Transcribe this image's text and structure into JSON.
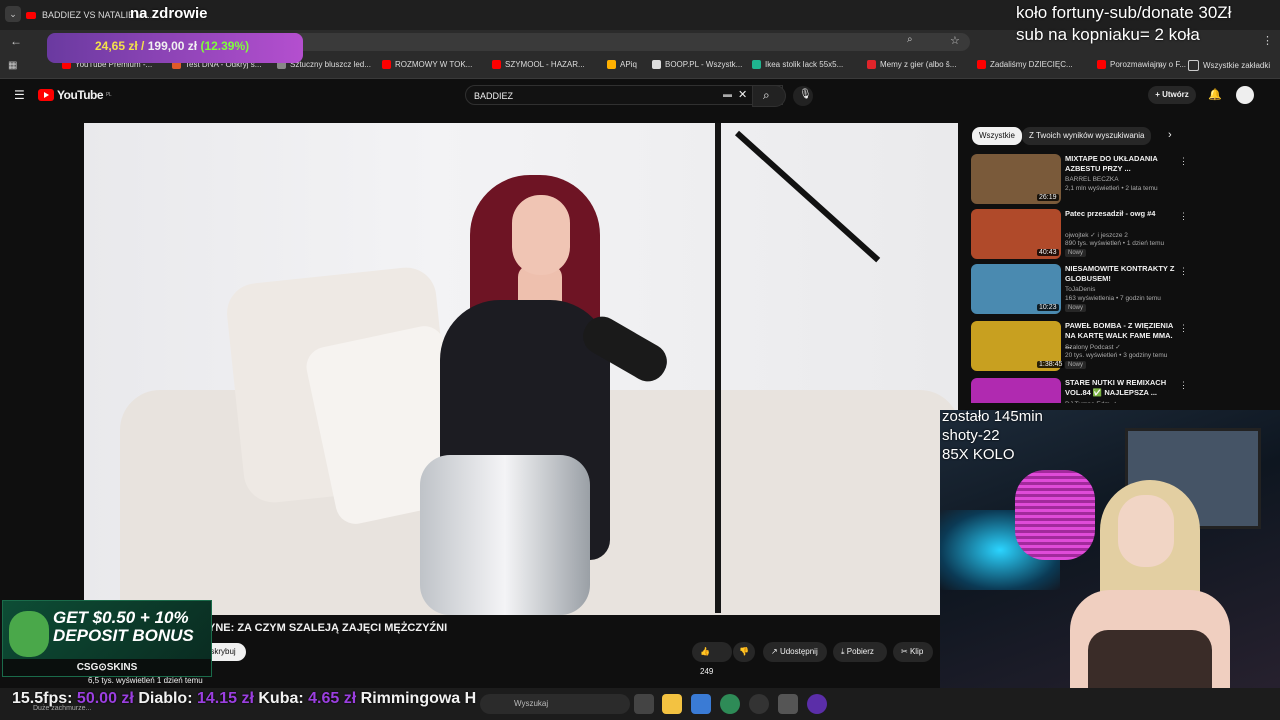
{
  "browser": {
    "tab_title": "BADDIEZ VS NATALIE W...",
    "bookmarks": [
      {
        "label": "YouTube Premium -...",
        "color": "#ff0000"
      },
      {
        "label": "Test DNA - Odkryj s...",
        "color": "#e05a2a"
      },
      {
        "label": "Sztuczny bluszcz led...",
        "color": "#888888"
      },
      {
        "label": "ROZMOWY W TOK...",
        "color": "#ff0000"
      },
      {
        "label": "SZYMOOL - HAZAR...",
        "color": "#ff0000"
      },
      {
        "label": "APiq",
        "color": "#ffb000"
      },
      {
        "label": "BOOP.PL - Wszystk...",
        "color": "#dddddd"
      },
      {
        "label": "Ikea stolik lack 55x5...",
        "color": "#1fb58f"
      },
      {
        "label": "Memy z gier (albo š...",
        "color": "#e0242a"
      },
      {
        "label": "Zadaliśmy DZIECIĘC...",
        "color": "#ff0000"
      },
      {
        "label": "Porozmawiajmy o F...",
        "color": "#ff0000"
      }
    ],
    "all_bookmarks": "Wszystkie zakładki"
  },
  "youtube": {
    "logo": "YouTube",
    "logo_region": "PL",
    "search_value": "BADDIEZ",
    "create_label": "Utwórz",
    "video_title": "YNE: ZA CZYM SZALEJĄ ZAJĘCI MĘŻCZYŹNI",
    "subscribe_label": "skrybuj",
    "likes": "249",
    "share_label": "Udostępnij",
    "download_label": "Pobierz",
    "clip_label": "Klip",
    "views": "6,5 tys. wyświetleń  1 dzień temu",
    "description": "Duże zachmurze..."
  },
  "sidebar": {
    "chips": [
      "Wszystkie",
      "Z Twoich wyników wyszukiwania"
    ],
    "recommendations": [
      {
        "title": "MIXTAPE DO UKŁADANIA AZBESTU PRZY ...",
        "channel": "BARREL BECZKA",
        "meta": "2,1 mln wyświetleń • 2 lata temu",
        "duration": "26:19",
        "badge": "",
        "thumb": "#7a5a3a"
      },
      {
        "title": "Patec przesadził - owg #4",
        "channel": "ojwojtek ✓ i jeszcze 2",
        "meta": "890 tys. wyświetleń • 1 dzień temu",
        "duration": "40:43",
        "badge": "Nowy",
        "thumb": "#b04a2a"
      },
      {
        "title": "NIESAMOWITE KONTRAKTY Z GLOBUSEM!",
        "channel": "ToJaDenis",
        "meta": "163 wyświetlenia • 7 godzin temu",
        "duration": "10:23",
        "badge": "Nowy",
        "thumb": "#4a8ab0"
      },
      {
        "title": "PAWEŁ BOMBA - Z WIĘZIENIA NA KARTĘ WALK FAME MMA. ...",
        "channel": "Szalony Podcast ✓",
        "meta": "20 tys. wyświetleń • 3 godziny temu",
        "duration": "1:38:45",
        "badge": "Nowy",
        "thumb": "#c8a020"
      },
      {
        "title": "STARE NUTKI W REMIXACH VOL.84 ✅ NAJLEPSZA ...",
        "channel": "DJ Tumne Edm ✓",
        "meta": "",
        "duration": "",
        "badge": "",
        "thumb": "#b02ab0"
      }
    ]
  },
  "overlays": {
    "top_center": "na zdrowie",
    "top_right_1": "koło fortuny-sub/donate 30Zł",
    "top_right_2": "sub na kopniaku= 2 koła",
    "money_current": "24,65 zł",
    "money_slash": "/",
    "money_target": "199,00 zł",
    "money_pct": "(12.39%)",
    "stats": [
      "zostało 145min",
      "shoty-22",
      "85X KOLO"
    ],
    "ad_headline": "GET $0.50 + 10% DEPOSIT BONUS",
    "ad_brand": "CSG⊙SKINS",
    "ticker": [
      {
        "name": "15.5fps:",
        "value": "50.00 zł"
      },
      {
        "name": "Diablo:",
        "value": "14.15 zł"
      },
      {
        "name": "Kuba:",
        "value": "4.65 zł"
      },
      {
        "name": "Rimmingowa H",
        "value": ""
      }
    ]
  },
  "taskbar": {
    "search_placeholder": "Wyszukaj"
  }
}
